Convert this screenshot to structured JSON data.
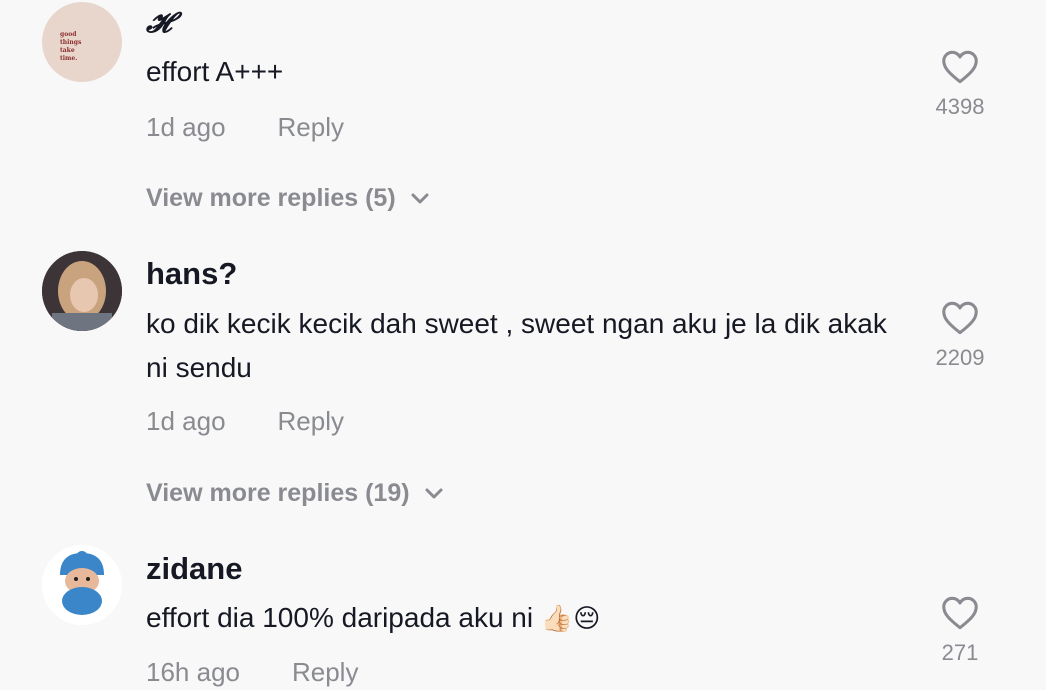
{
  "comments": [
    {
      "username": "𝓗",
      "avatar_text": [
        "good",
        "things",
        "take",
        "time."
      ],
      "text": "effort A+++",
      "time": "1d ago",
      "reply_label": "Reply",
      "likes": "4398",
      "view_more": "View more replies (5)"
    },
    {
      "username": "hans?",
      "text": "ko dik kecik kecik dah sweet , sweet ngan aku je la dik akak ni sendu",
      "time": "1d ago",
      "reply_label": "Reply",
      "likes": "2209",
      "view_more": "View more replies (19)"
    },
    {
      "username": "zidane",
      "text": "effort dia 100% daripada aku ni",
      "emoji": "👍🏻😔",
      "time": "16h ago",
      "reply_label": "Reply",
      "likes": "271"
    }
  ],
  "colors": {
    "text": "#161823",
    "muted": "#8a8b91",
    "background": "#f8f8f8"
  }
}
